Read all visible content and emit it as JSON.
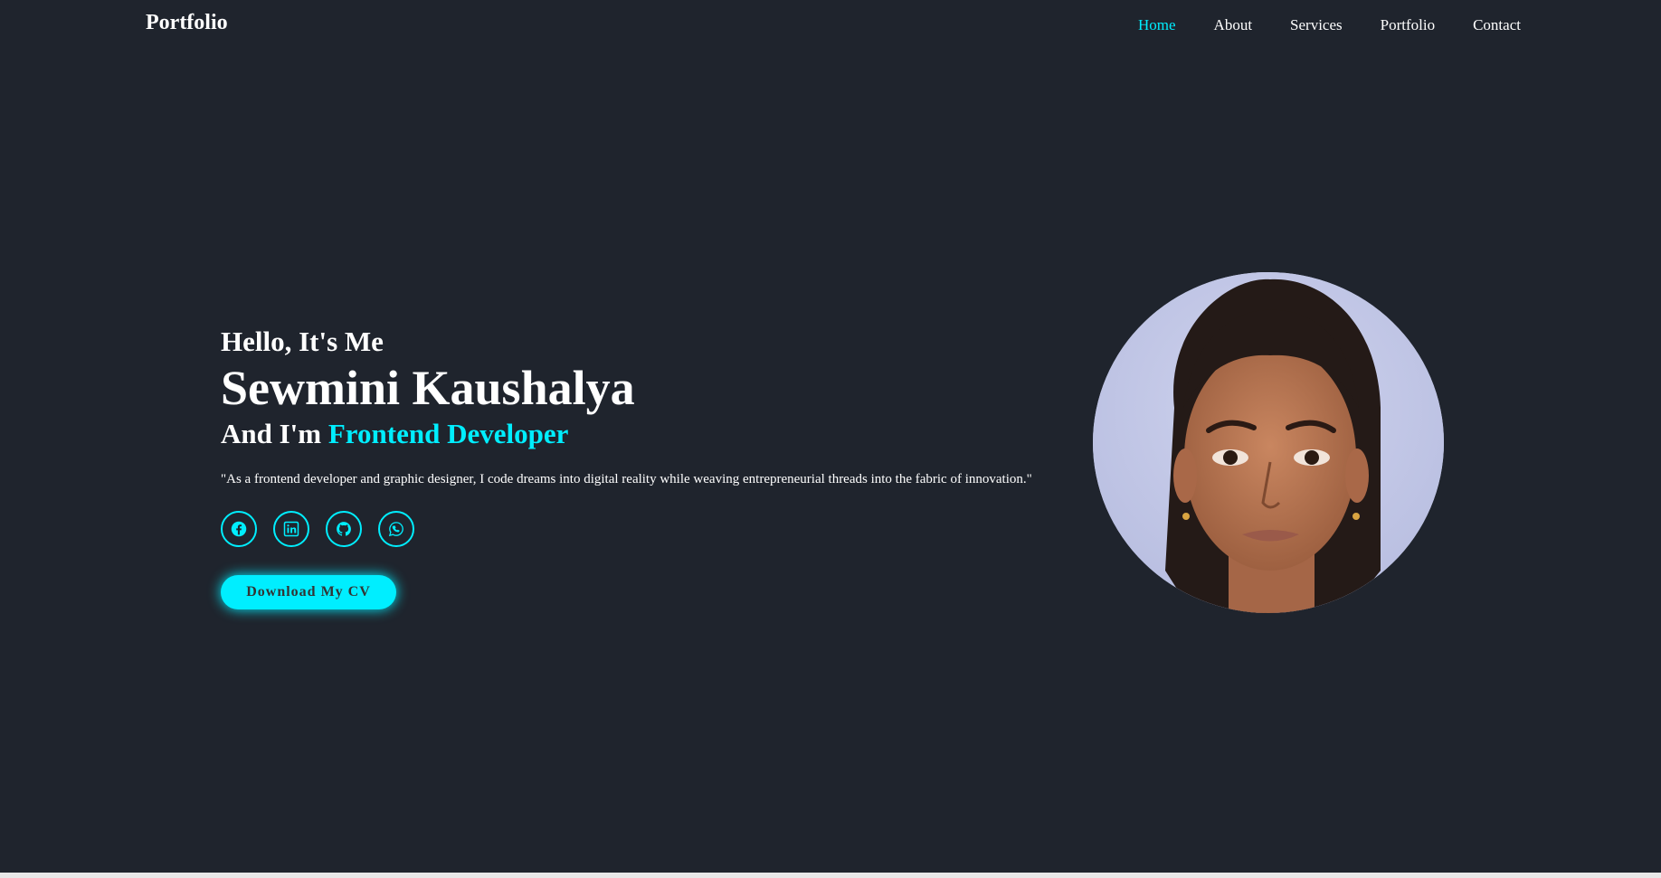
{
  "header": {
    "logo": "Portfolio",
    "nav": [
      {
        "label": "Home",
        "active": true
      },
      {
        "label": "About",
        "active": false
      },
      {
        "label": "Services",
        "active": false
      },
      {
        "label": "Portfolio",
        "active": false
      },
      {
        "label": "Contact",
        "active": false
      }
    ]
  },
  "home": {
    "greeting": "Hello, It's Me",
    "name": "Sewmini Kaushalya",
    "role_prefix": "And I'm",
    "role": "Frontend Developer",
    "quote": "\"As a frontend developer and graphic designer, I code dreams into digital reality while weaving entrepreneurial threads into the fabric of innovation.\"",
    "socials": [
      {
        "icon": "facebook-icon"
      },
      {
        "icon": "linkedin-icon"
      },
      {
        "icon": "github-icon"
      },
      {
        "icon": "whatsapp-icon"
      }
    ],
    "cv_button": "Download My CV"
  },
  "colors": {
    "background": "#1f242d",
    "accent": "#00eeff",
    "text": "#ffffff"
  }
}
